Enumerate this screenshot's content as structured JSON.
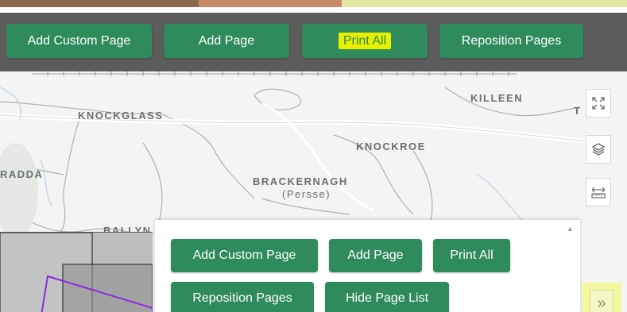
{
  "toolbar": {
    "buttons": [
      {
        "label": "Add Custom Page"
      },
      {
        "label": "Add Page"
      },
      {
        "label": "Print All",
        "highlighted": true
      },
      {
        "label": "Reposition Pages"
      }
    ]
  },
  "map": {
    "places": [
      {
        "name": "KILLEEN"
      },
      {
        "name": "KNOCKGLASS"
      },
      {
        "name": "KNOCKROE"
      },
      {
        "name": "RADDA"
      },
      {
        "name": "BRACKERNAGH"
      },
      {
        "name": "(Persse)"
      },
      {
        "name": "BALLYN"
      },
      {
        "name": "T"
      }
    ],
    "tools": [
      {
        "icon": "fullscreen-icon"
      },
      {
        "icon": "layers-icon"
      },
      {
        "icon": "measure-icon"
      },
      {
        "icon": "chevron-double-right-icon",
        "highlighted": true
      }
    ]
  },
  "page_panel": {
    "buttons": [
      {
        "label": "Add Custom Page"
      },
      {
        "label": "Add Page"
      },
      {
        "label": "Print All"
      },
      {
        "label": "Reposition Pages"
      },
      {
        "label": "Hide Page List"
      }
    ]
  },
  "colors": {
    "button_green": "#2f8a5c",
    "toolbar_bg": "#5c5c5c",
    "highlight_yellow": "#e8f000"
  }
}
